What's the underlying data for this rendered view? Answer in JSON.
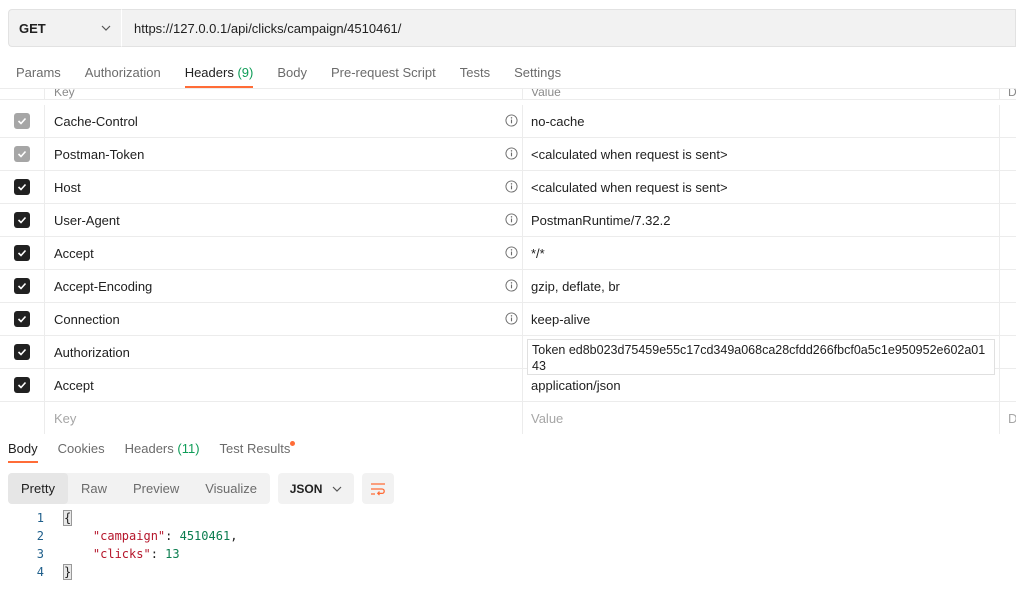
{
  "request": {
    "method": "GET",
    "url": "https://127.0.0.1/api/clicks/campaign/4510461/"
  },
  "request_tabs": [
    {
      "label": "Params"
    },
    {
      "label": "Authorization"
    },
    {
      "label": "Headers",
      "count": "(9)"
    },
    {
      "label": "Body"
    },
    {
      "label": "Pre-request Script"
    },
    {
      "label": "Tests"
    },
    {
      "label": "Settings"
    }
  ],
  "headers_table": {
    "columns": {
      "key": "Key",
      "value": "Value",
      "description": "D"
    },
    "rows": [
      {
        "key": "Cache-Control",
        "value": "no-cache"
      },
      {
        "key": "Postman-Token",
        "value": "<calculated when request is sent>"
      },
      {
        "key": "Host",
        "value": "<calculated when request is sent>"
      },
      {
        "key": "User-Agent",
        "value": "PostmanRuntime/7.32.2"
      },
      {
        "key": "Accept",
        "value": "*/*"
      },
      {
        "key": "Accept-Encoding",
        "value": "gzip, deflate, br"
      },
      {
        "key": "Connection",
        "value": "keep-alive"
      },
      {
        "key": "Authorization",
        "value": "Token ed8b023d75459e55c17cd349a068ca28cfdd266fbcf0a5c1e950952e602a0143"
      },
      {
        "key": "Accept",
        "value": "application/json"
      }
    ],
    "new_row": {
      "key_placeholder": "Key",
      "value_placeholder": "Value",
      "description_placeholder": "D"
    }
  },
  "response_tabs": [
    {
      "label": "Body"
    },
    {
      "label": "Cookies"
    },
    {
      "label": "Headers",
      "count": "(11)"
    },
    {
      "label": "Test Results"
    }
  ],
  "view_modes": [
    "Pretty",
    "Raw",
    "Preview",
    "Visualize"
  ],
  "format": "JSON",
  "code": {
    "line_numbers": [
      "1",
      "2",
      "3",
      "4"
    ],
    "open_brace": "{",
    "close_brace": "}",
    "campaign_key": "\"campaign\"",
    "campaign_value": "4510461",
    "clicks_key": "\"clicks\"",
    "clicks_value": "13"
  }
}
